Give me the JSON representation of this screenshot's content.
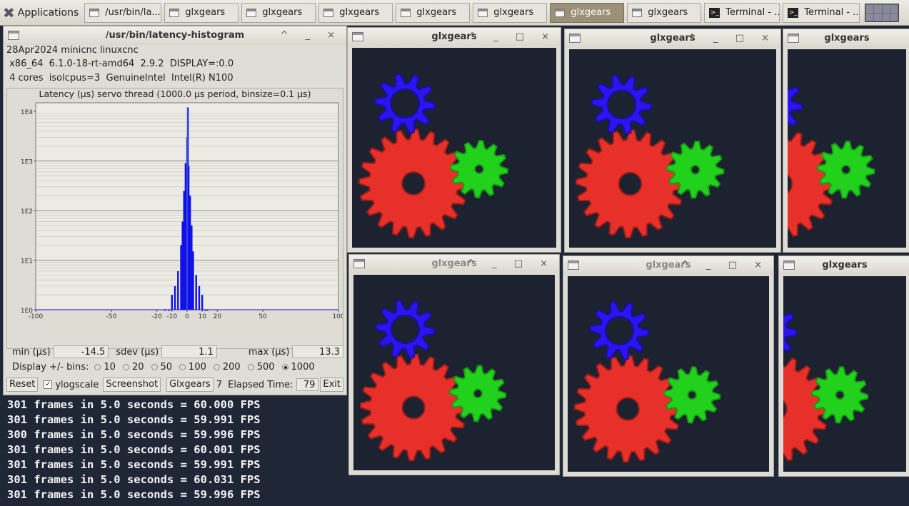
{
  "taskbar": {
    "apps_label": "Applications",
    "tasks": [
      {
        "label": "/usr/bin/la...",
        "type": "window",
        "active": false
      },
      {
        "label": "glxgears",
        "type": "window",
        "active": false
      },
      {
        "label": "glxgears",
        "type": "window",
        "active": false
      },
      {
        "label": "glxgears",
        "type": "window",
        "active": false
      },
      {
        "label": "glxgears",
        "type": "window",
        "active": false
      },
      {
        "label": "glxgears",
        "type": "window",
        "active": false
      },
      {
        "label": "glxgears",
        "type": "window",
        "active": true
      },
      {
        "label": "glxgears",
        "type": "window",
        "active": false
      },
      {
        "label": "Terminal - ...",
        "type": "terminal",
        "active": false
      },
      {
        "label": "Terminal - ...",
        "type": "terminal",
        "active": false
      }
    ]
  },
  "histogram": {
    "window_title": "/usr/bin/latency-histogram",
    "line1": "28Apr2024 minicnc linuxcnc",
    "line2": " x86_64  6.1.0-18-rt-amd64  2.9.2  DISPLAY=:0.0",
    "line3": " 4 cores  isolcpus=3  GenuineIntel  Intel(R) N100",
    "plot_title": "Latency (µs) servo thread (1000.0 µs period, binsize=0.1 µs)",
    "y_ticks": [
      "1E4",
      "1E3",
      "1E2",
      "1E1",
      "1E0"
    ],
    "x_ticks": [
      "-100",
      "-50",
      "-20",
      "-10",
      "0",
      "10",
      "20",
      "50",
      "100"
    ],
    "min_label": "min (µs)",
    "min_value": "-14.5",
    "sdev_label": "sdev (µs)",
    "sdev_value": "1.1",
    "max_label": "max (µs)",
    "max_value": "13.3",
    "bins_label": "Display +/- bins:",
    "bins_options": [
      "10",
      "20",
      "50",
      "100",
      "200",
      "500",
      "1000"
    ],
    "bins_selected": "1000",
    "reset_label": "Reset",
    "ylogscale_label": "ylogscale",
    "screenshot_label": "Screenshot",
    "glxgears_label": "Glxgears",
    "glxgears_count": "7",
    "elapsed_label": "Elapsed Time:",
    "elapsed_value": "79",
    "exit_label": "Exit"
  },
  "chart_data": {
    "type": "bar",
    "title": "Latency (µs) servo thread (1000.0 µs period, binsize=0.1 µs)",
    "xlabel": "",
    "ylabel": "",
    "log_y": true,
    "xlim": [
      -100,
      100
    ],
    "ylim": [
      1,
      10000
    ],
    "x": [
      -14.5,
      -12,
      -10,
      -8,
      -6,
      -4,
      -3,
      -2,
      -1,
      0,
      0.5,
      1,
      2,
      3,
      4,
      6,
      8,
      10,
      12,
      13.3
    ],
    "values": [
      1,
      1,
      2,
      3,
      6,
      20,
      60,
      250,
      900,
      3000,
      12000,
      800,
      200,
      50,
      15,
      5,
      3,
      2,
      1,
      1
    ],
    "grid": true,
    "bar_color": "#1010e8"
  },
  "glxgears": {
    "windows": [
      {
        "title": "glxgears",
        "focused": true
      },
      {
        "title": "glxgears",
        "focused": true
      },
      {
        "title": "glxgears",
        "focused": true
      },
      {
        "title": "glxgears",
        "focused": false
      },
      {
        "title": "glxgears",
        "focused": false
      },
      {
        "title": "glxgears",
        "focused": true
      }
    ],
    "window_controls": "^ _ □ ×",
    "colors": {
      "red": "#e8302a",
      "green": "#22d11c",
      "blue": "#2a14f0",
      "bg": "#1c2230"
    }
  },
  "terminal": {
    "lines": [
      "301 frames in 5.0 seconds = 60.000 FPS",
      "301 frames in 5.0 seconds = 59.991 FPS",
      "300 frames in 5.0 seconds = 59.996 FPS",
      "301 frames in 5.0 seconds = 60.001 FPS",
      "301 frames in 5.0 seconds = 59.991 FPS",
      "301 frames in 5.0 seconds = 60.031 FPS",
      "301 frames in 5.0 seconds = 59.996 FPS"
    ]
  }
}
